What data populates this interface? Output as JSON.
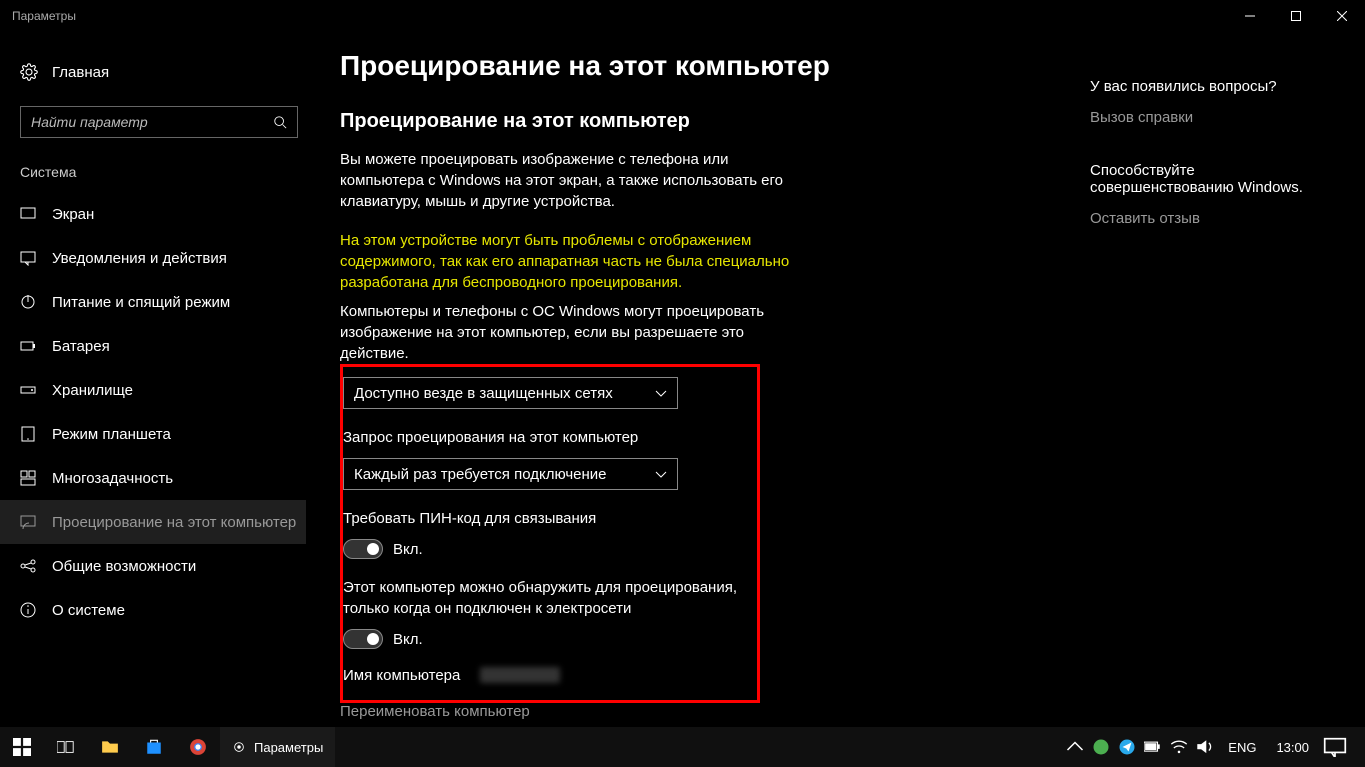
{
  "window": {
    "title": "Параметры"
  },
  "titlebar_tooltips": {
    "min": "Свернуть",
    "max": "Развернуть",
    "close": "Закрыть"
  },
  "sidebar": {
    "home": "Главная",
    "search_placeholder": "Найти параметр",
    "section": "Система",
    "items": [
      {
        "icon": "display",
        "label": "Экран"
      },
      {
        "icon": "notify",
        "label": "Уведомления и действия"
      },
      {
        "icon": "power",
        "label": "Питание и спящий режим"
      },
      {
        "icon": "battery",
        "label": "Батарея"
      },
      {
        "icon": "storage",
        "label": "Хранилище"
      },
      {
        "icon": "tablet",
        "label": "Режим планшета"
      },
      {
        "icon": "multitask",
        "label": "Многозадачность"
      },
      {
        "icon": "project",
        "label": "Проецирование на этот компьютер",
        "selected": true
      },
      {
        "icon": "shared",
        "label": "Общие возможности"
      },
      {
        "icon": "about",
        "label": "О системе"
      }
    ]
  },
  "page": {
    "title": "Проецирование на этот компьютер",
    "subheading": "Проецирование на этот компьютер",
    "intro": "Вы можете проецировать изображение с телефона или компьютера с Windows на этот экран, а также использовать его клавиатуру, мышь и другие устройства.",
    "warning": "На этом устройстве могут быть проблемы с отображением содержимого, так как его аппаратная часть не была специально разработана для беспроводного проецирования.",
    "allow_label": "Компьютеры и телефоны с ОС Windows могут проецировать изображение на этот компьютер, если вы разрешаете это действие.",
    "dropdown1": {
      "value": "Доступно везде в защищенных сетях"
    },
    "ask_label": "Запрос проецирования на этот компьютер",
    "dropdown2": {
      "value": "Каждый раз требуется подключение"
    },
    "pin_label": "Требовать ПИН-код для связывания",
    "pin_state": "Вкл.",
    "power_label": "Этот компьютер можно обнаружить для проецирования, только когда он подключен к электросети",
    "power_state": "Вкл.",
    "pcname_label": "Имя компьютера",
    "rename": "Переименовать компьютер"
  },
  "right": {
    "q_head": "У вас появились вопросы?",
    "q_link": "Вызов справки",
    "fb_head": "Способствуйте совершенствованию Windows.",
    "fb_link": "Оставить отзыв"
  },
  "taskbar": {
    "app_label": "Параметры",
    "lang": "ENG",
    "time": "13:00"
  }
}
